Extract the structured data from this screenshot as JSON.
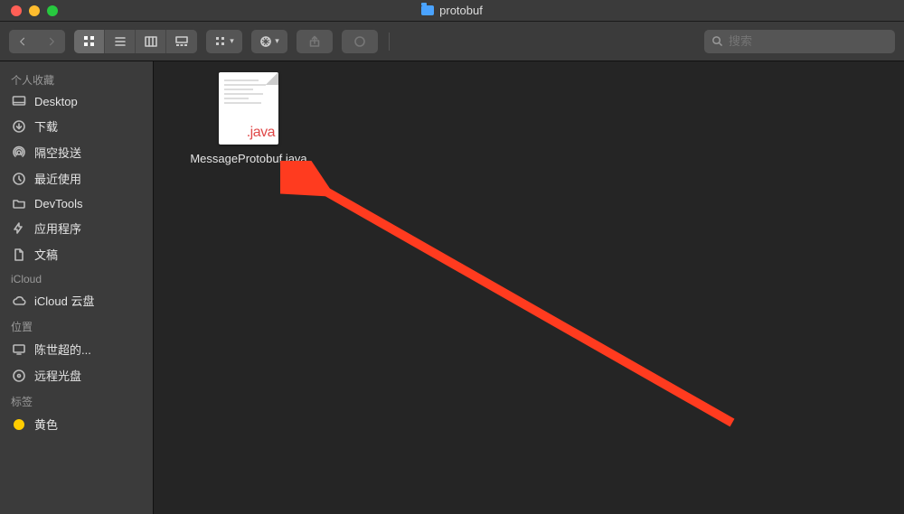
{
  "window": {
    "title": "protobuf"
  },
  "toolbar": {
    "search_placeholder": "搜索"
  },
  "sidebar": {
    "sections": [
      {
        "header": "个人收藏",
        "items": [
          {
            "label": "Desktop",
            "icon": "desktop-icon"
          },
          {
            "label": "下载",
            "icon": "download-icon"
          },
          {
            "label": "隔空投送",
            "icon": "airdrop-icon"
          },
          {
            "label": "最近使用",
            "icon": "clock-icon"
          },
          {
            "label": "DevTools",
            "icon": "folder-icon"
          },
          {
            "label": "应用程序",
            "icon": "apps-icon"
          },
          {
            "label": "文稿",
            "icon": "document-icon"
          }
        ]
      },
      {
        "header": "iCloud",
        "items": [
          {
            "label": "iCloud 云盘",
            "icon": "cloud-icon"
          }
        ]
      },
      {
        "header": "位置",
        "items": [
          {
            "label": "陈世超的...",
            "icon": "computer-icon"
          },
          {
            "label": "远程光盘",
            "icon": "disc-icon"
          }
        ]
      },
      {
        "header": "标签",
        "items": [
          {
            "label": "黄色",
            "icon": "tag-yellow"
          }
        ]
      }
    ]
  },
  "content": {
    "files": [
      {
        "name": "MessageProtobuf.java",
        "badge": ".java"
      }
    ]
  }
}
